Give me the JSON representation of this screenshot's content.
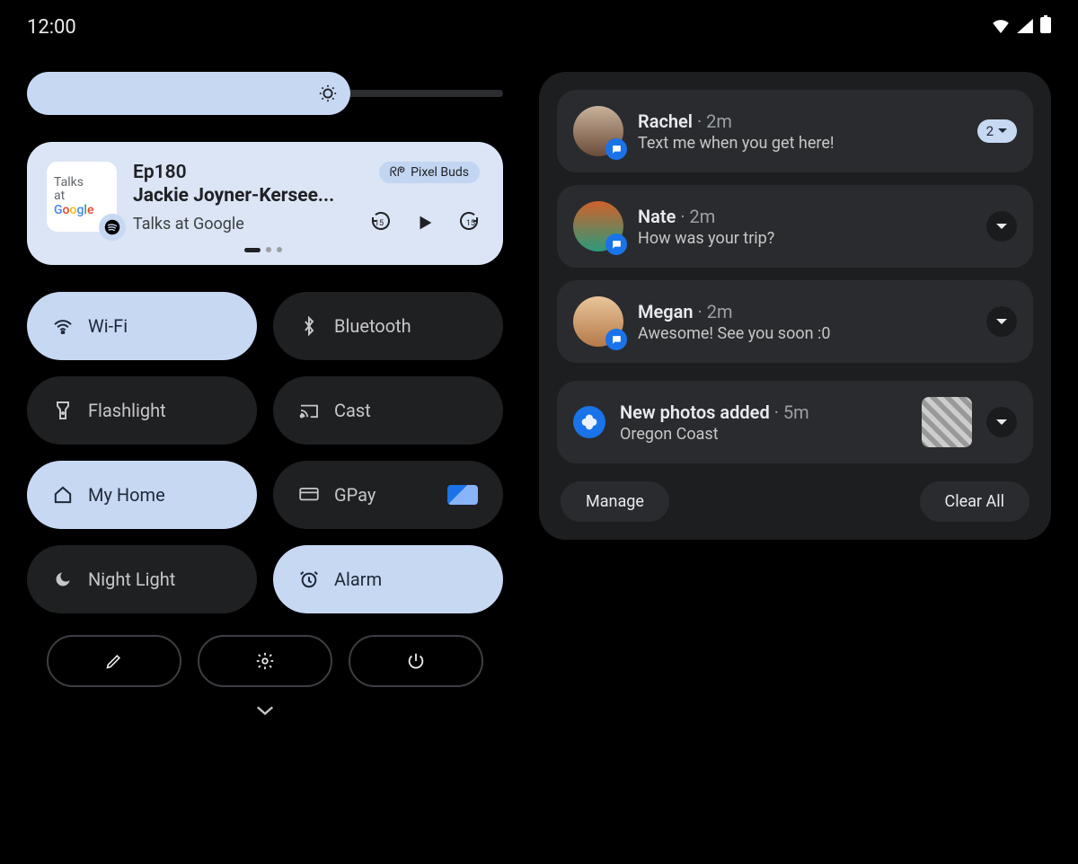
{
  "statusbar": {
    "time": "12:00"
  },
  "media": {
    "art_line1": "Talks",
    "art_line2": "at",
    "title": "Ep180",
    "artist": "Jackie Joyner-Kersee...",
    "source": "Talks at Google",
    "output_chip": "Pixel Buds",
    "skip_back_label": "15",
    "skip_fwd_label": "15"
  },
  "tiles": {
    "wifi": "Wi-Fi",
    "bluetooth": "Bluetooth",
    "flashlight": "Flashlight",
    "cast": "Cast",
    "home": "My Home",
    "gpay": "GPay",
    "nightlight": "Night Light",
    "alarm": "Alarm"
  },
  "notifications": [
    {
      "name": "Rachel",
      "time": "2m",
      "body": "Text me when you get here!",
      "count": "2"
    },
    {
      "name": "Nate",
      "time": "2m",
      "body": "How was your trip?"
    },
    {
      "name": "Megan",
      "time": "2m",
      "body": "Awesome! See you soon :0"
    }
  ],
  "photos_notif": {
    "title": "New photos added",
    "time": "5m",
    "subtitle": "Oregon Coast"
  },
  "actions": {
    "manage": "Manage",
    "clear": "Clear All"
  }
}
